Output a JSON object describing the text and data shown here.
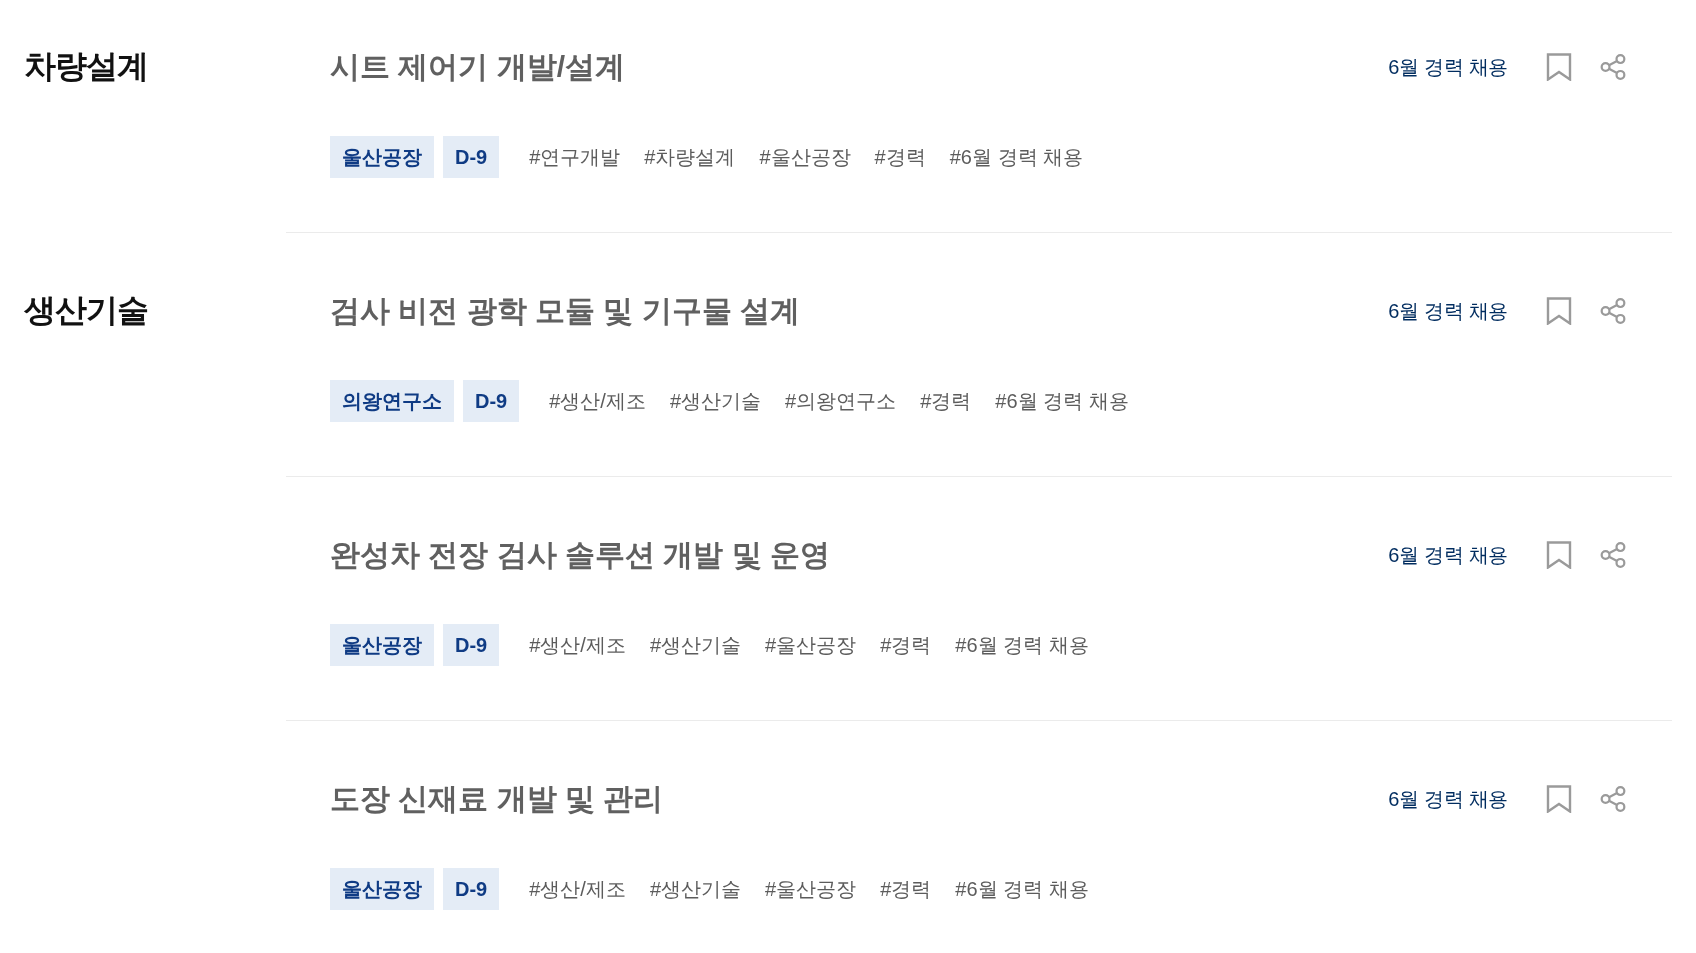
{
  "groups": [
    {
      "category": "차량설계",
      "jobs": [
        {
          "title": "시트 제어기 개발/설계",
          "recruit": "6월 경력 채용",
          "bookmarked": false,
          "badges": [
            "울산공장",
            "D-9"
          ],
          "tags": [
            "#연구개발",
            "#차량설계",
            "#울산공장",
            "#경력",
            "#6월 경력 채용"
          ]
        }
      ]
    },
    {
      "category": "생산기술",
      "jobs": [
        {
          "title": "검사 비전 광학 모듈 및 기구물 설계",
          "recruit": "6월 경력 채용",
          "bookmarked": false,
          "badges": [
            "의왕연구소",
            "D-9"
          ],
          "tags": [
            "#생산/제조",
            "#생산기술",
            "#의왕연구소",
            "#경력",
            "#6월 경력 채용"
          ]
        },
        {
          "title": "완성차 전장 검사 솔루션 개발 및 운영",
          "recruit": "6월 경력 채용",
          "bookmarked": false,
          "badges": [
            "울산공장",
            "D-9"
          ],
          "tags": [
            "#생산/제조",
            "#생산기술",
            "#울산공장",
            "#경력",
            "#6월 경력 채용"
          ]
        },
        {
          "title": "도장 신재료 개발 및 관리",
          "recruit": "6월 경력 채용",
          "bookmarked": false,
          "badges": [
            "울산공장",
            "D-9"
          ],
          "tags": [
            "#생산/제조",
            "#생산기술",
            "#울산공장",
            "#경력",
            "#6월 경력 채용"
          ]
        }
      ]
    }
  ]
}
